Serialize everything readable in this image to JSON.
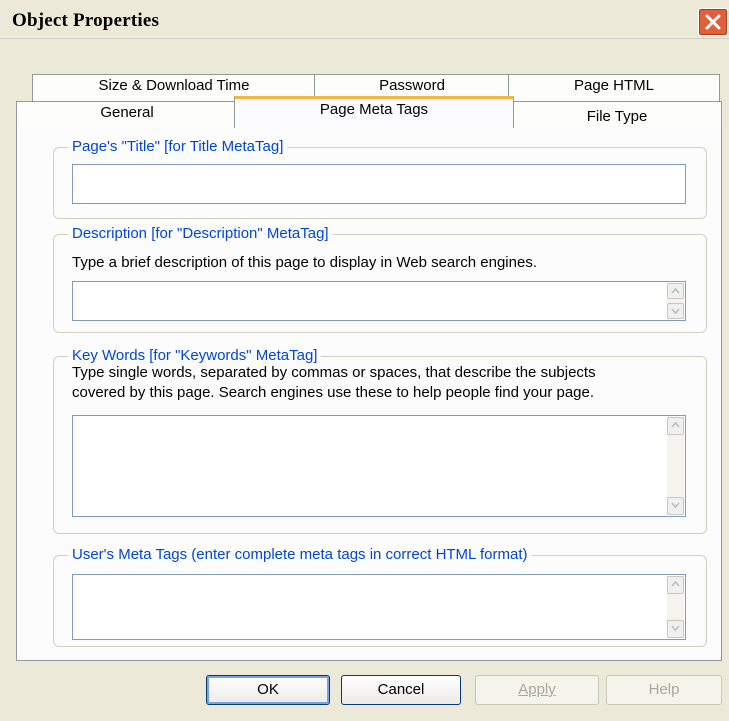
{
  "window": {
    "title": "Object Properties"
  },
  "tabs_back": [
    {
      "label": "Size & Download Time"
    },
    {
      "label": "Password"
    },
    {
      "label": "Page HTML"
    }
  ],
  "tabs_front": [
    {
      "label": "General"
    },
    {
      "label": "Page Meta Tags"
    },
    {
      "label": "File Type"
    }
  ],
  "title_group": {
    "legend": "Page's \"Title\" [for Title MetaTag]",
    "value": ""
  },
  "description_group": {
    "legend": "Description [for \"Description\" MetaTag]",
    "help": "Type a brief description of this page to display in Web search engines.",
    "value": ""
  },
  "keywords_group": {
    "legend": "Key Words [for \"Keywords\" MetaTag]",
    "help_line1": "Type single words, separated by commas or spaces,  that describe the subjects",
    "help_line2": "covered by this page. Search engines use these to help people find your page.",
    "value": ""
  },
  "user_meta_group": {
    "legend": "User's Meta Tags (enter complete meta tags in correct HTML format)",
    "value": ""
  },
  "buttons": {
    "ok": "OK",
    "cancel": "Cancel",
    "apply": "Apply",
    "help": "Help"
  }
}
